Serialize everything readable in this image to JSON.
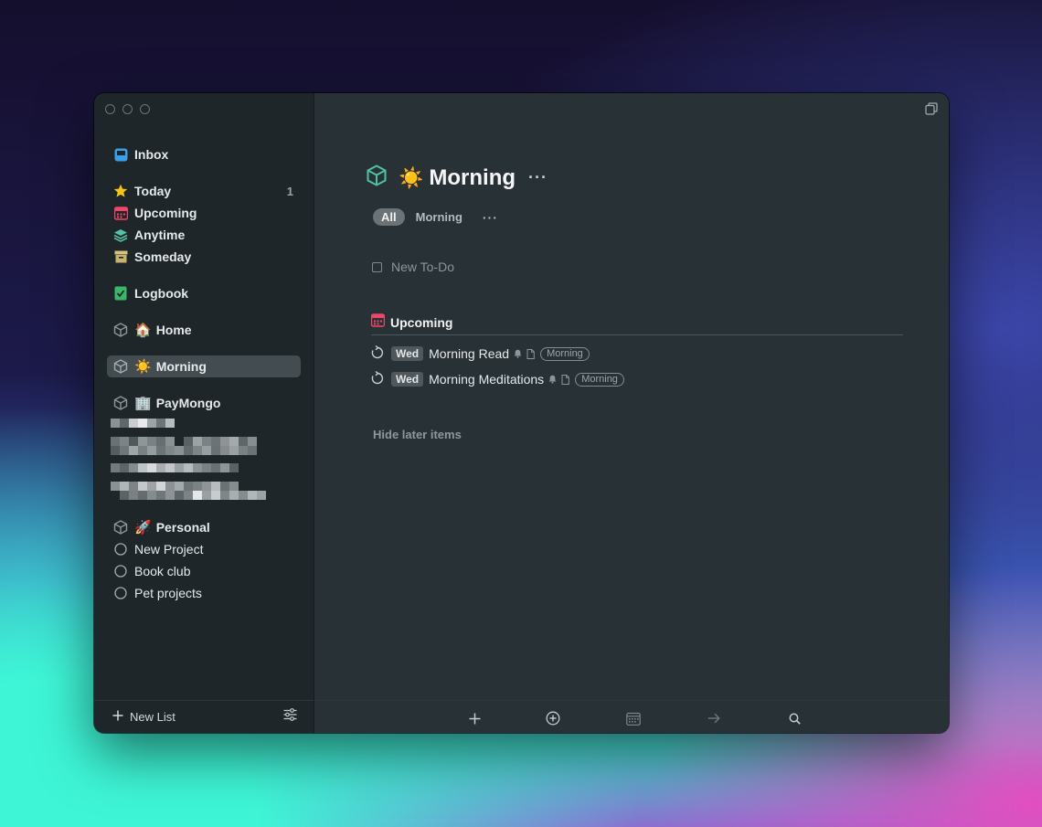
{
  "sidebar": {
    "inbox": {
      "label": "Inbox",
      "icon": "inbox-icon",
      "color": "#3b9ee8"
    },
    "today": {
      "label": "Today",
      "icon": "star-icon",
      "count": "1",
      "color": "#f5c518"
    },
    "upcoming": {
      "label": "Upcoming",
      "icon": "calendar-icon",
      "color": "#f0466a"
    },
    "anytime": {
      "label": "Anytime",
      "icon": "layers-icon",
      "color": "#55c2a8"
    },
    "someday": {
      "label": "Someday",
      "icon": "archive-box-icon",
      "color": "#d8c27a"
    },
    "logbook": {
      "label": "Logbook",
      "icon": "logbook-check-icon",
      "color": "#3ab86a"
    },
    "areas": [
      {
        "emoji": "🏠",
        "label": "Home",
        "icon": "area-cube-icon"
      },
      {
        "emoji": "☀️",
        "label": "Morning",
        "icon": "area-cube-icon",
        "selected": true
      },
      {
        "emoji": "🏢",
        "label": "PayMongo",
        "icon": "area-cube-icon"
      },
      {
        "emoji": "🚀",
        "label": "Personal",
        "icon": "area-cube-icon"
      }
    ],
    "personal_projects": [
      {
        "label": "New Project",
        "icon": "project-circle-icon"
      },
      {
        "label": "Book club",
        "icon": "project-circle-icon"
      },
      {
        "label": "Pet projects",
        "icon": "project-circle-icon"
      }
    ],
    "footer": {
      "new_list_label": "New List",
      "plus_icon": "plus-icon",
      "filter_icon": "sliders-icon"
    }
  },
  "main": {
    "title_emoji": "☀️",
    "title": "Morning",
    "title_icon": "area-cube-icon",
    "title_icon_color": "#4fc1a3",
    "more_label": "···",
    "tabs": [
      {
        "label": "All",
        "active": true
      },
      {
        "label": "Morning",
        "active": false
      }
    ],
    "tabs_more_label": "···",
    "new_todo_placeholder": "New To-Do",
    "upcoming_section": {
      "label": "Upcoming",
      "icon": "calendar-icon"
    },
    "todos": [
      {
        "when": "Wed",
        "title": "Morning Read",
        "tag": "Morning",
        "icons": [
          "repeat-icon",
          "bell-icon",
          "note-icon"
        ]
      },
      {
        "when": "Wed",
        "title": "Morning Meditations",
        "tag": "Morning",
        "icons": [
          "repeat-icon",
          "bell-icon",
          "note-icon"
        ]
      }
    ],
    "hide_later_label": "Hide later items",
    "toolbar": [
      "plus-icon",
      "add-circle-icon",
      "calendar-icon",
      "arrow-right-icon",
      "search-icon"
    ]
  }
}
